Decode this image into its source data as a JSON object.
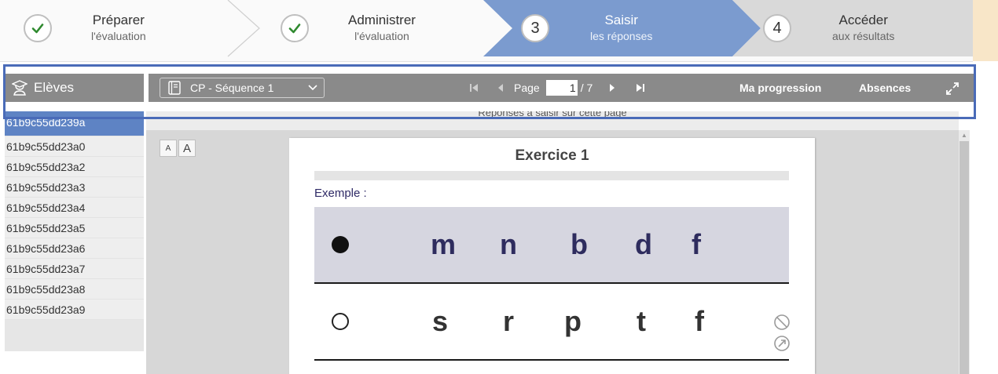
{
  "stepper": {
    "steps": [
      {
        "number": "",
        "line1": "Préparer",
        "line2": "l'évaluation",
        "state": "done"
      },
      {
        "number": "",
        "line1": "Administrer",
        "line2": "l'évaluation",
        "state": "done"
      },
      {
        "number": "3",
        "line1": "Saisir",
        "line2": "les réponses",
        "state": "active"
      },
      {
        "number": "4",
        "line1": "Accéder",
        "line2": "aux résultats",
        "state": "todo"
      }
    ],
    "colors": {
      "active": "#7b9bcf",
      "todo": "#d9d9d9",
      "done": "#fafafa"
    }
  },
  "toolbar": {
    "students_label": "Elèves",
    "sequence_value": "CP - Séquence 1",
    "page_label": "Page",
    "page_value": "1",
    "page_total": "/ 7",
    "progression_label": "Ma progression",
    "absences_label": "Absences"
  },
  "banner": {
    "text": "Réponses à saisir sur cette page"
  },
  "students": [
    "61b9c55dd239a",
    "61b9c55dd23a0",
    "61b9c55dd23a2",
    "61b9c55dd23a3",
    "61b9c55dd23a4",
    "61b9c55dd23a5",
    "61b9c55dd23a6",
    "61b9c55dd23a7",
    "61b9c55dd23a8",
    "61b9c55dd23a9"
  ],
  "font_buttons": {
    "small": "A",
    "large": "A"
  },
  "exercise": {
    "title": "Exercice 1",
    "example_label": "Exemple :",
    "example_letters": [
      "m",
      "n",
      "b",
      "d",
      "f"
    ],
    "question_letters": [
      "s",
      "r",
      "p",
      "t",
      "f"
    ]
  },
  "icons": {
    "students": "student-icon",
    "sequence": "book-icon",
    "expand": "expand-icon",
    "skip": "no-answer-icon",
    "undo": "reset-icon"
  }
}
